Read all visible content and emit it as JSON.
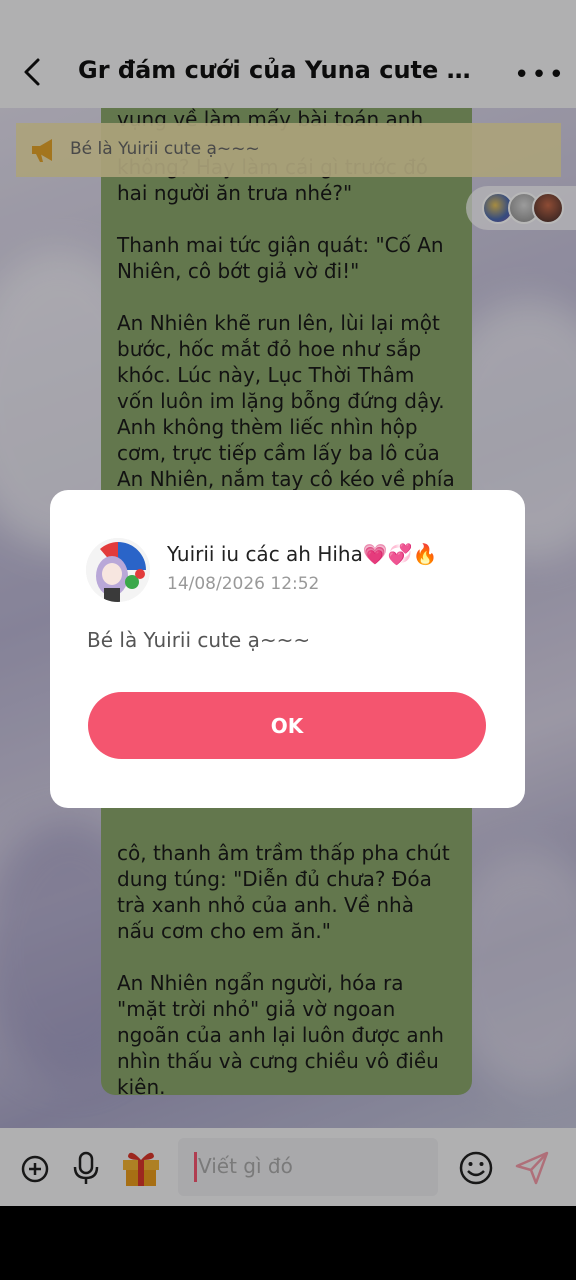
{
  "header": {
    "title": "Gr đám cưới của Yuna cute 💗💕..."
  },
  "pinned": {
    "text": "Bé là Yuirii cute ạ~~~"
  },
  "message": {
    "paragraphs": [
      "vụng về làm mấy bài toán anh",
      "không? Hay làm cái gì trước đó hai người ăn trưa nhé?\"",
      "Thanh mai tức giận quát: \"Cố An Nhiên, cô bớt giả vờ đi!\"",
      "An Nhiên khẽ run lên, lùi lại một bước, hốc mắt đỏ hoe như sắp khóc. Lúc này, Lục Thời Thâm vốn luôn im lặng bỗng đứng dậy. Anh không thèm liếc nhìn hộp cơm, trực tiếp cầm lấy ba lô của An Nhiên, nắm tay cô kéo về phía mình. Anh",
      "cô, thanh âm trầm thấp pha chút dung túng: \"Diễn đủ chưa? Đóa trà xanh nhỏ của anh. Về nhà nấu cơm cho em ăn.\"",
      "An Nhiên ngẩn người, hóa ra \"mặt trời nhỏ\" giả vờ ngoan ngoãn của anh lại luôn được anh nhìn thấu và cưng chiều vô điều kiện."
    ]
  },
  "dialog": {
    "sender": "Yuirii iu các ah Hiha💗💞🔥",
    "time": "14/08/2026 12:52",
    "text": "Bé là Yuirii cute ạ~~~",
    "ok_label": "OK"
  },
  "composer": {
    "placeholder": "Viết gì đó"
  },
  "colors": {
    "accent": "#f4556f",
    "bubble": "#8aa66b",
    "pin_bg": "#eee2aa"
  }
}
